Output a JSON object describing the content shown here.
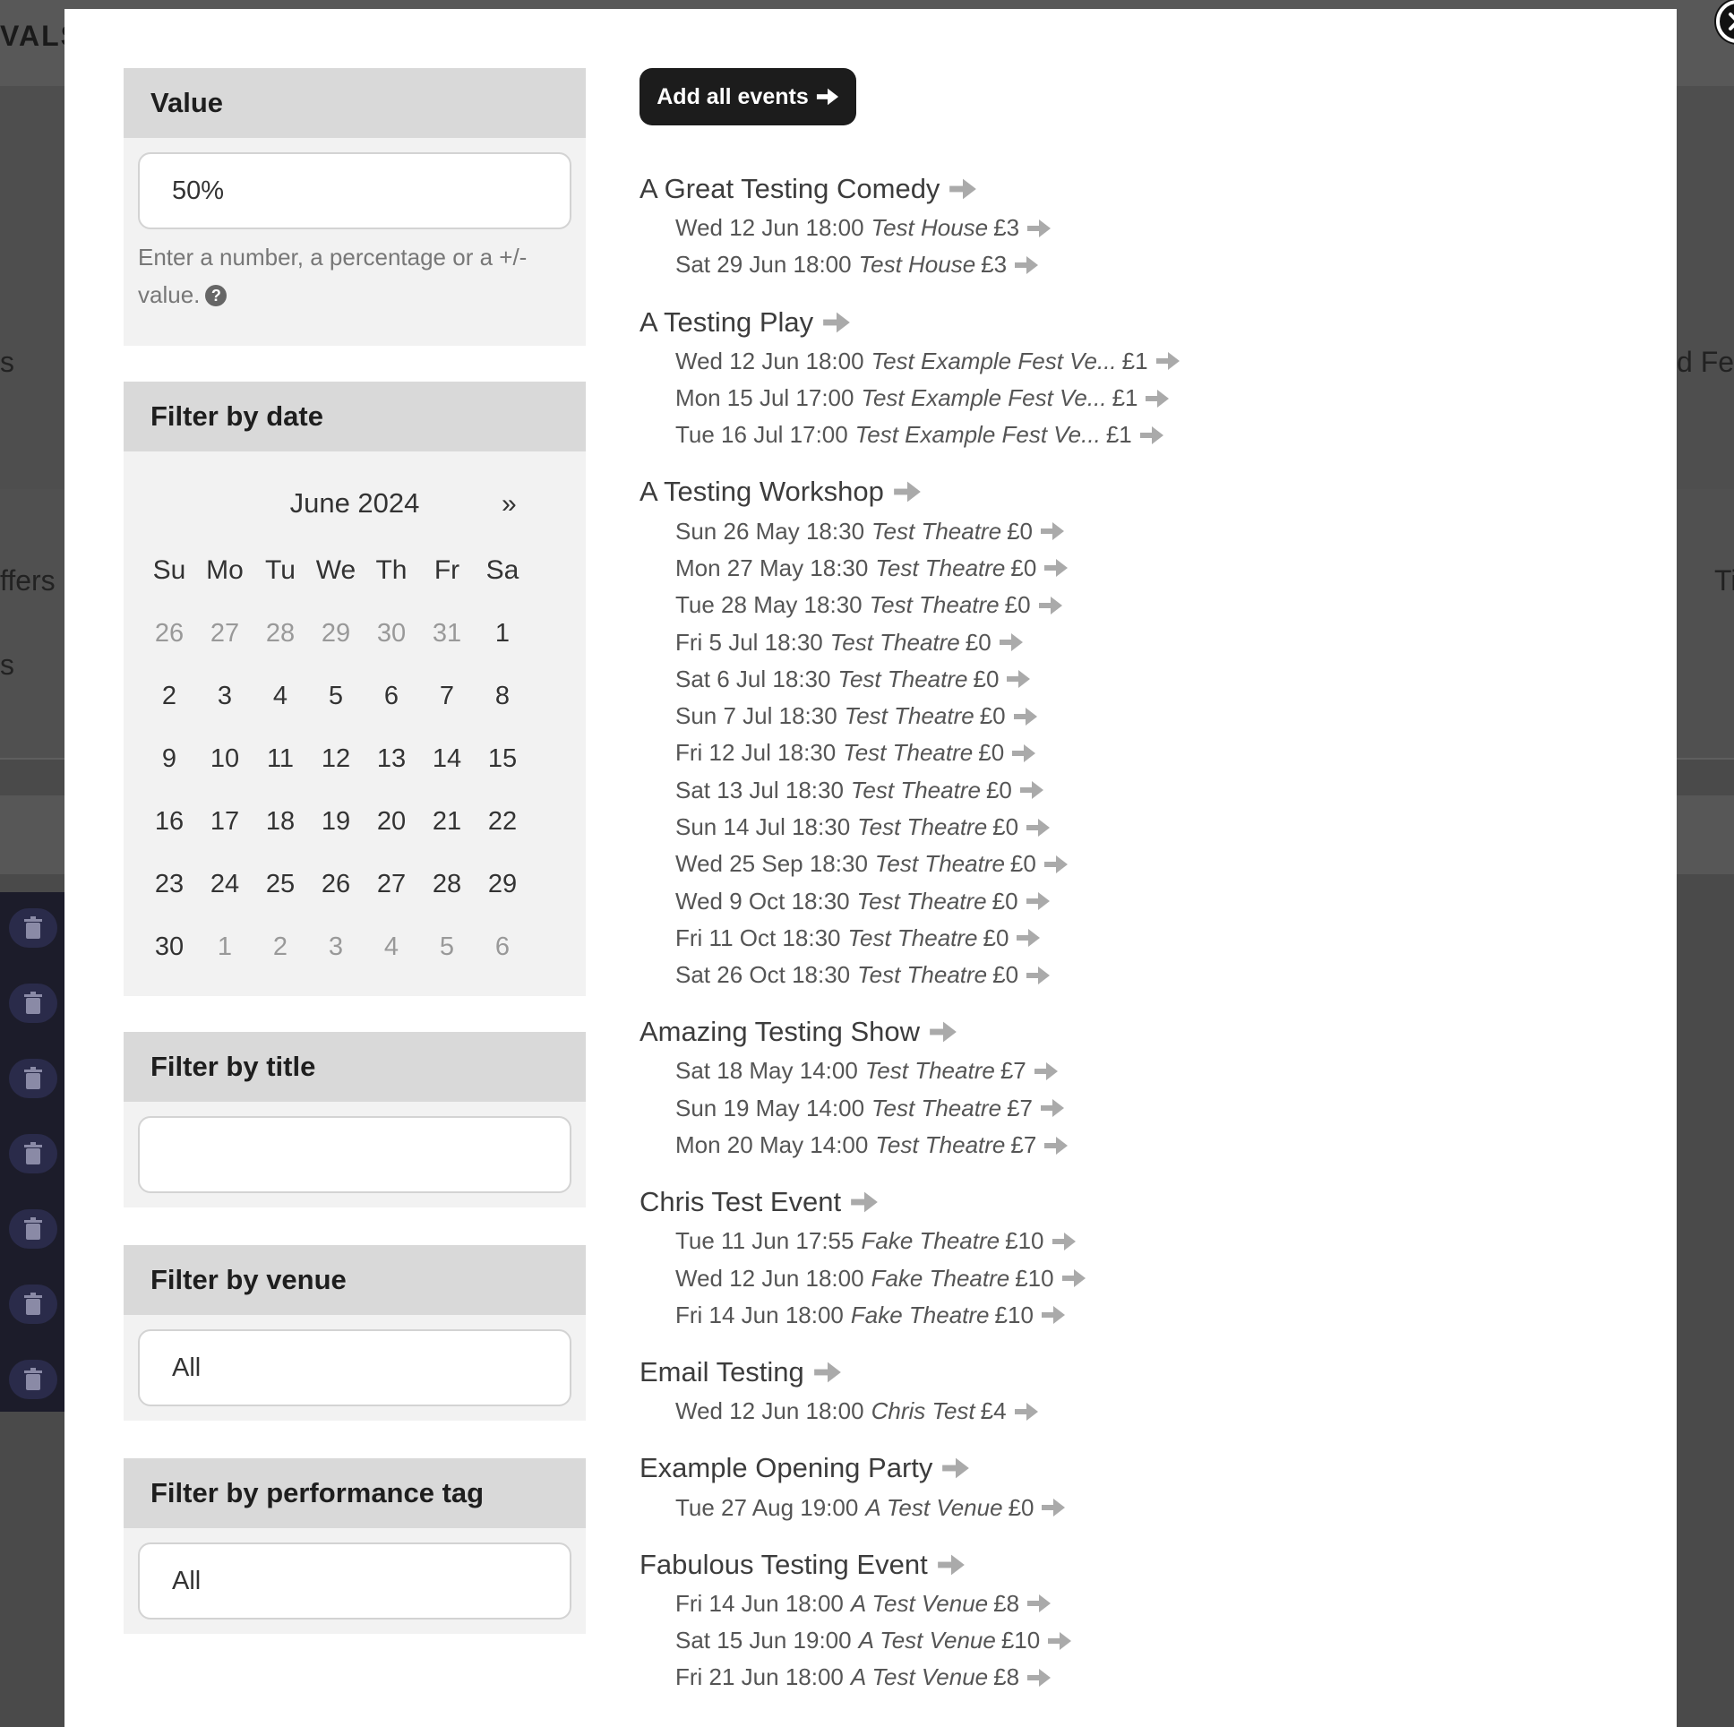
{
  "background": {
    "logo_text": "VALS",
    "left_labels": [
      "s",
      "ffers",
      "s"
    ],
    "right_labels": [
      "d Fea",
      "Ti"
    ]
  },
  "value_panel": {
    "heading": "Value",
    "value": "50%",
    "hint": "Enter a number, a percentage or a +/- value.",
    "help_icon": "?"
  },
  "date_panel": {
    "heading": "Filter by date",
    "month_label": "June 2024",
    "next_label": "»",
    "weekdays": [
      "Su",
      "Mo",
      "Tu",
      "We",
      "Th",
      "Fr",
      "Sa"
    ],
    "weeks": [
      [
        {
          "d": "26",
          "m": true
        },
        {
          "d": "27",
          "m": true
        },
        {
          "d": "28",
          "m": true
        },
        {
          "d": "29",
          "m": true
        },
        {
          "d": "30",
          "m": true
        },
        {
          "d": "31",
          "m": true
        },
        {
          "d": "1",
          "m": false
        }
      ],
      [
        {
          "d": "2",
          "m": false
        },
        {
          "d": "3",
          "m": false
        },
        {
          "d": "4",
          "m": false
        },
        {
          "d": "5",
          "m": false
        },
        {
          "d": "6",
          "m": false
        },
        {
          "d": "7",
          "m": false
        },
        {
          "d": "8",
          "m": false
        }
      ],
      [
        {
          "d": "9",
          "m": false
        },
        {
          "d": "10",
          "m": false
        },
        {
          "d": "11",
          "m": false
        },
        {
          "d": "12",
          "m": false
        },
        {
          "d": "13",
          "m": false
        },
        {
          "d": "14",
          "m": false
        },
        {
          "d": "15",
          "m": false
        }
      ],
      [
        {
          "d": "16",
          "m": false
        },
        {
          "d": "17",
          "m": false
        },
        {
          "d": "18",
          "m": false
        },
        {
          "d": "19",
          "m": false
        },
        {
          "d": "20",
          "m": false
        },
        {
          "d": "21",
          "m": false
        },
        {
          "d": "22",
          "m": false
        }
      ],
      [
        {
          "d": "23",
          "m": false
        },
        {
          "d": "24",
          "m": false
        },
        {
          "d": "25",
          "m": false
        },
        {
          "d": "26",
          "m": false
        },
        {
          "d": "27",
          "m": false
        },
        {
          "d": "28",
          "m": false
        },
        {
          "d": "29",
          "m": false
        }
      ],
      [
        {
          "d": "30",
          "m": false
        },
        {
          "d": "1",
          "m": true
        },
        {
          "d": "2",
          "m": true
        },
        {
          "d": "3",
          "m": true
        },
        {
          "d": "4",
          "m": true
        },
        {
          "d": "5",
          "m": true
        },
        {
          "d": "6",
          "m": true
        }
      ]
    ]
  },
  "title_panel": {
    "heading": "Filter by title",
    "value": ""
  },
  "venue_panel": {
    "heading": "Filter by venue",
    "value": "All"
  },
  "tag_panel": {
    "heading": "Filter by performance tag",
    "value": "All"
  },
  "add_all_label": "Add all events",
  "events": [
    {
      "title": "A Great Testing Comedy",
      "performances": [
        {
          "when": "Wed 12 Jun 18:00",
          "venue": "Test House",
          "price": "£3"
        },
        {
          "when": "Sat 29 Jun 18:00",
          "venue": "Test House",
          "price": "£3"
        }
      ]
    },
    {
      "title": "A Testing Play",
      "performances": [
        {
          "when": "Wed 12 Jun 18:00",
          "venue": "Test Example Fest Ve...",
          "price": "£1"
        },
        {
          "when": "Mon 15 Jul 17:00",
          "venue": "Test Example Fest Ve...",
          "price": "£1"
        },
        {
          "when": "Tue 16 Jul 17:00",
          "venue": "Test Example Fest Ve...",
          "price": "£1"
        }
      ]
    },
    {
      "title": "A Testing Workshop",
      "performances": [
        {
          "when": "Sun 26 May 18:30",
          "venue": "Test Theatre",
          "price": "£0"
        },
        {
          "when": "Mon 27 May 18:30",
          "venue": "Test Theatre",
          "price": "£0"
        },
        {
          "when": "Tue 28 May 18:30",
          "venue": "Test Theatre",
          "price": "£0"
        },
        {
          "when": "Fri 5 Jul 18:30",
          "venue": "Test Theatre",
          "price": "£0"
        },
        {
          "when": "Sat 6 Jul 18:30",
          "venue": "Test Theatre",
          "price": "£0"
        },
        {
          "when": "Sun 7 Jul 18:30",
          "venue": "Test Theatre",
          "price": "£0"
        },
        {
          "when": "Fri 12 Jul 18:30",
          "venue": "Test Theatre",
          "price": "£0"
        },
        {
          "when": "Sat 13 Jul 18:30",
          "venue": "Test Theatre",
          "price": "£0"
        },
        {
          "when": "Sun 14 Jul 18:30",
          "venue": "Test Theatre",
          "price": "£0"
        },
        {
          "when": "Wed 25 Sep 18:30",
          "venue": "Test Theatre",
          "price": "£0"
        },
        {
          "when": "Wed 9 Oct 18:30",
          "venue": "Test Theatre",
          "price": "£0"
        },
        {
          "when": "Fri 11 Oct 18:30",
          "venue": "Test Theatre",
          "price": "£0"
        },
        {
          "when": "Sat 26 Oct 18:30",
          "venue": "Test Theatre",
          "price": "£0"
        }
      ]
    },
    {
      "title": "Amazing Testing Show",
      "performances": [
        {
          "when": "Sat 18 May 14:00",
          "venue": "Test Theatre",
          "price": "£7"
        },
        {
          "when": "Sun 19 May 14:00",
          "venue": "Test Theatre",
          "price": "£7"
        },
        {
          "when": "Mon 20 May 14:00",
          "venue": "Test Theatre",
          "price": "£7"
        }
      ]
    },
    {
      "title": "Chris Test Event",
      "performances": [
        {
          "when": "Tue 11 Jun 17:55",
          "venue": "Fake Theatre",
          "price": "£10"
        },
        {
          "when": "Wed 12 Jun 18:00",
          "venue": "Fake Theatre",
          "price": "£10"
        },
        {
          "when": "Fri 14 Jun 18:00",
          "venue": "Fake Theatre",
          "price": "£10"
        }
      ]
    },
    {
      "title": "Email Testing",
      "performances": [
        {
          "when": "Wed 12 Jun 18:00",
          "venue": "Chris Test",
          "price": "£4"
        }
      ]
    },
    {
      "title": "Example Opening Party",
      "performances": [
        {
          "when": "Tue 27 Aug 19:00",
          "venue": "A Test Venue",
          "price": "£0"
        }
      ]
    },
    {
      "title": "Fabulous Testing Event",
      "performances": [
        {
          "when": "Fri 14 Jun 18:00",
          "venue": "A Test Venue",
          "price": "£8"
        },
        {
          "when": "Sat 15 Jun 19:00",
          "venue": "A Test Venue",
          "price": "£10"
        },
        {
          "when": "Fri 21 Jun 18:00",
          "venue": "A Test Venue",
          "price": "£8"
        }
      ]
    }
  ]
}
